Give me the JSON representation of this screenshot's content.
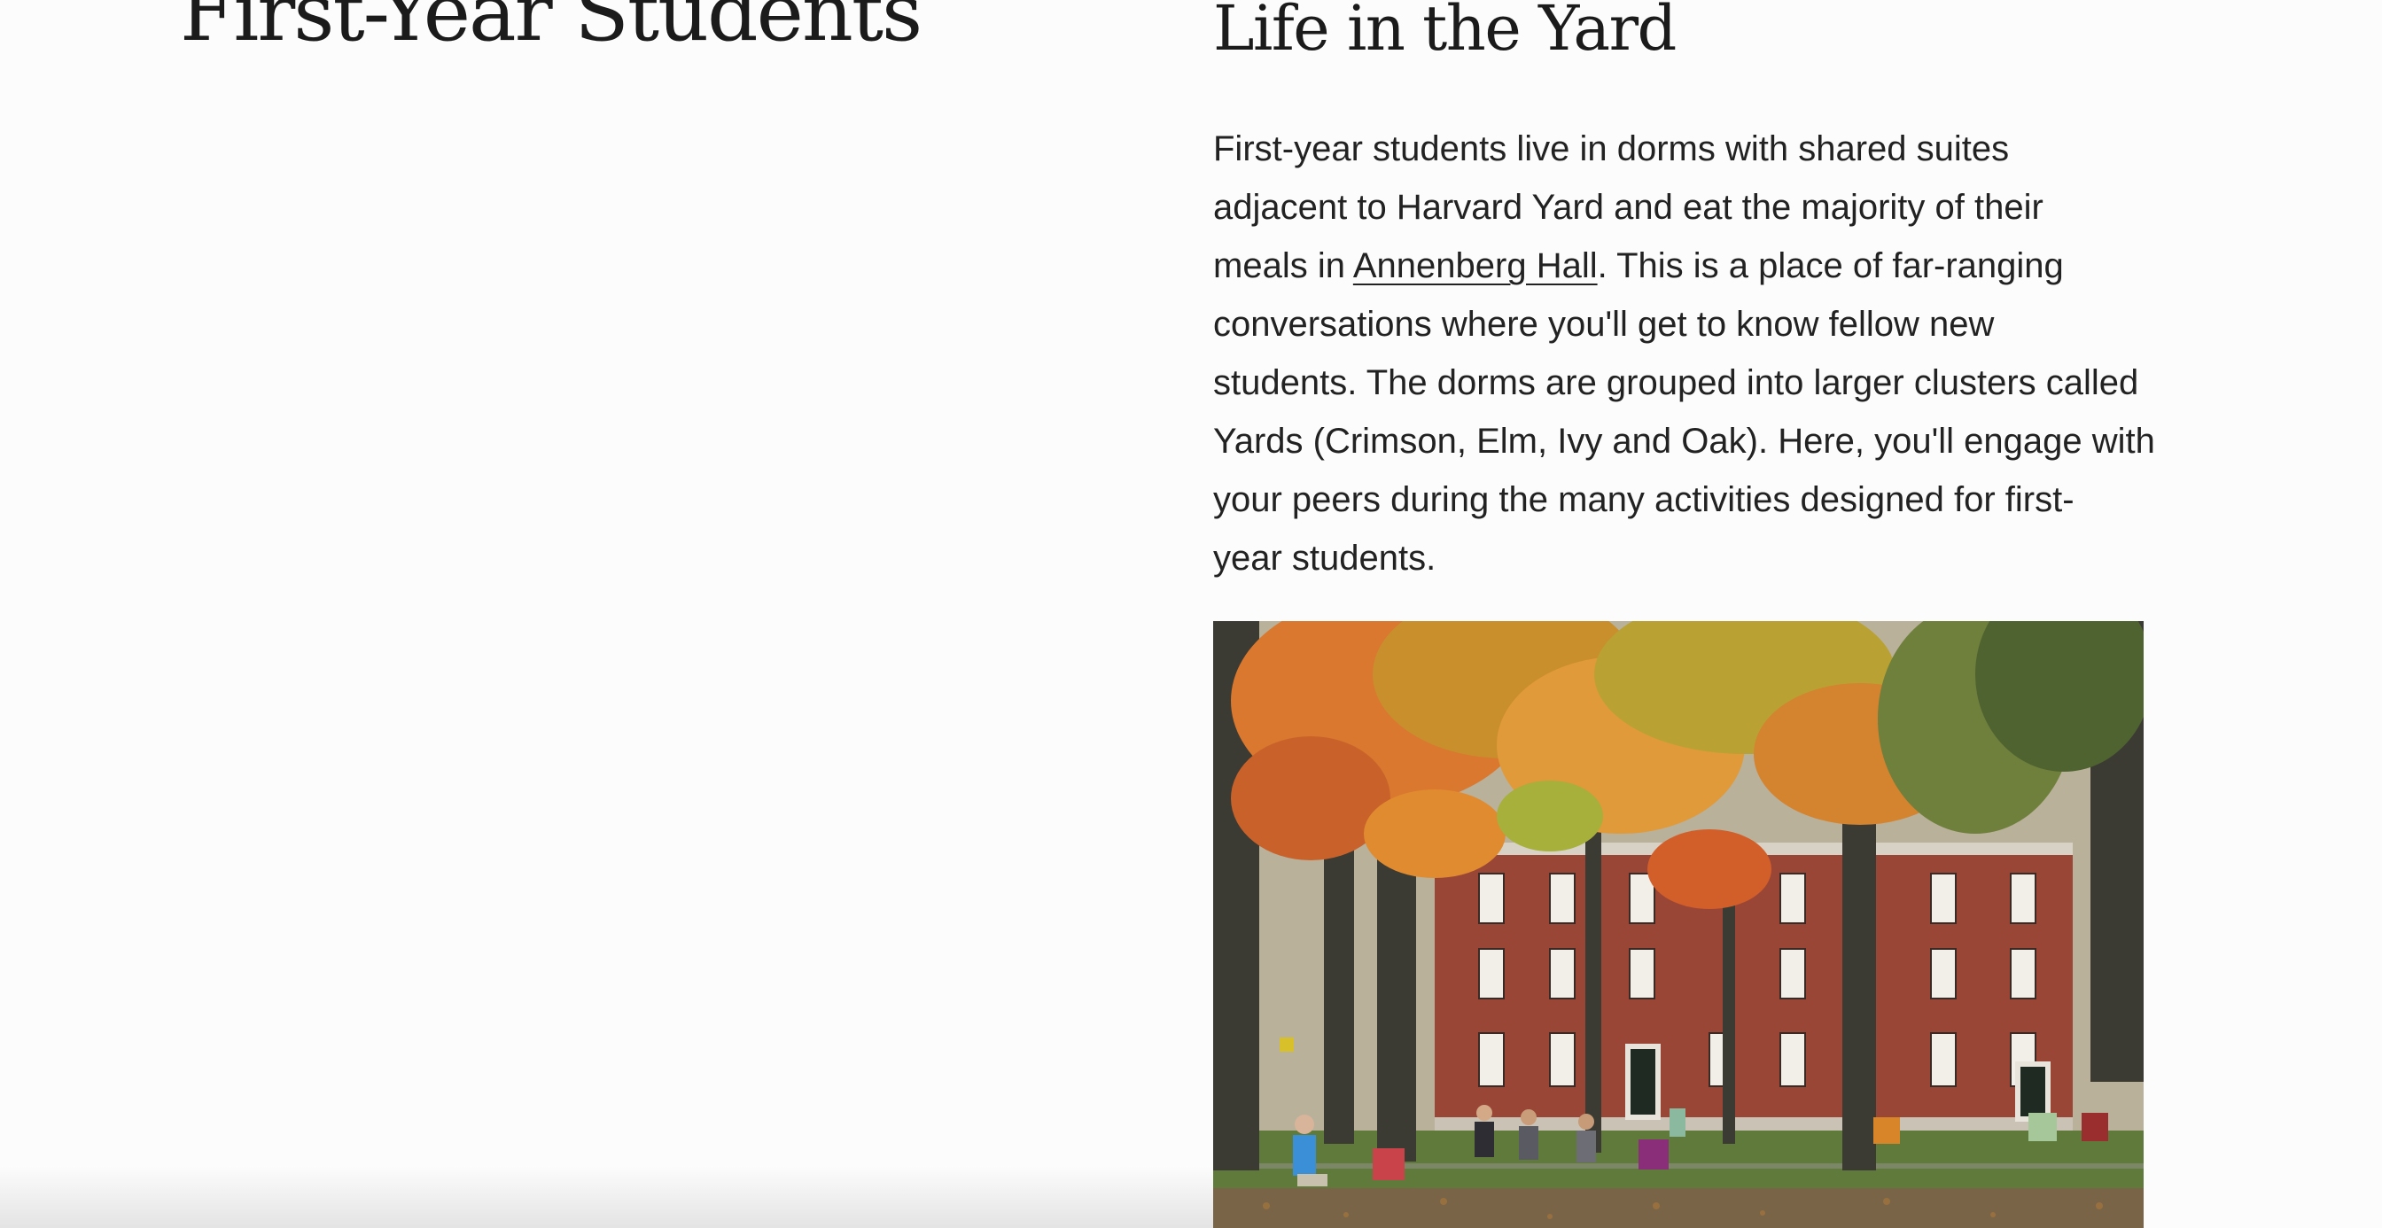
{
  "page": {
    "heading": "First-Year Students"
  },
  "section": {
    "heading": "Life in the Yard",
    "paragraph": {
      "line1": "First-year students live in dorms with shared suites",
      "line2": "adjacent to Harvard Yard and eat the majority of their",
      "line3_before": "meals in ",
      "line3_link": "Annenberg Hall",
      "line3_after": ". This is a place of far-ranging",
      "line4": "conversations where you'll get to know fellow new",
      "line5": "students. The dorms are grouped into larger clusters called",
      "line6": "Yards (Crimson, Elm, Ivy and Oak). Here, you'll engage with",
      "line7": "your peers during the many activities designed for first-",
      "line8": "year students."
    }
  },
  "colors": {
    "background": "#fcfcfc",
    "text": "#1e1e1e",
    "brick": "#9a4637",
    "foliage_orange": "#d9782e",
    "grass": "#5f7a3a"
  }
}
